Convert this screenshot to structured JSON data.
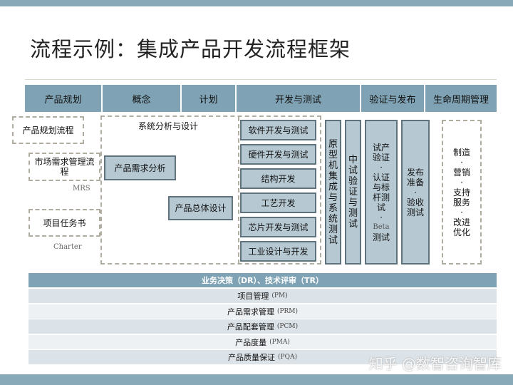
{
  "title": "流程示例：集成产品开发流程框架",
  "phases": [
    "产品规划",
    "概念",
    "计划",
    "开发与测试",
    "验证与发布",
    "生命周期管理"
  ],
  "planning": {
    "process": "产品规划流程",
    "market": "市场需求管理流程",
    "mrs": "MRS",
    "charter_doc": "项目任务书",
    "charter": "Charter"
  },
  "system": {
    "label": "系统分析与设计",
    "req": "产品需求分析",
    "design": "产品总体设计"
  },
  "dev": [
    "软件开发与测试",
    "硬件开发与测试",
    "结构开发",
    "工艺开发",
    "芯片开发与测试",
    "工业设计与开发"
  ],
  "vertical": {
    "prototype": [
      "原",
      "型",
      "机",
      "集",
      "成",
      "与",
      "系",
      "统",
      "测",
      "试"
    ],
    "pilot": [
      "中",
      "试",
      "验",
      "证",
      "与",
      "测",
      "试"
    ],
    "verify": [
      "试产",
      "验证",
      "·",
      "认证",
      "与标",
      "杆测",
      "试",
      "·",
      "Beta",
      "测试"
    ],
    "release": [
      "发布",
      "准备",
      "·",
      "验收",
      "测试"
    ]
  },
  "lifecycle": [
    "制造",
    "·",
    "营销",
    "·",
    "支持",
    "服务",
    "·",
    "改进",
    "优化"
  ],
  "table": {
    "header": "业务决策（DR）、技术评审（TR）",
    "rows": [
      {
        "cn": "项目管理",
        "en": "(PM)"
      },
      {
        "cn": "产品需求管理",
        "en": "(PRM)"
      },
      {
        "cn": "产品配套管理",
        "en": "(PCM)"
      },
      {
        "cn": "产品度量",
        "en": "(PMA)"
      },
      {
        "cn": "产品质量保证",
        "en": "(PQA)"
      }
    ]
  },
  "watermark": "知乎 @数智咨询智库"
}
